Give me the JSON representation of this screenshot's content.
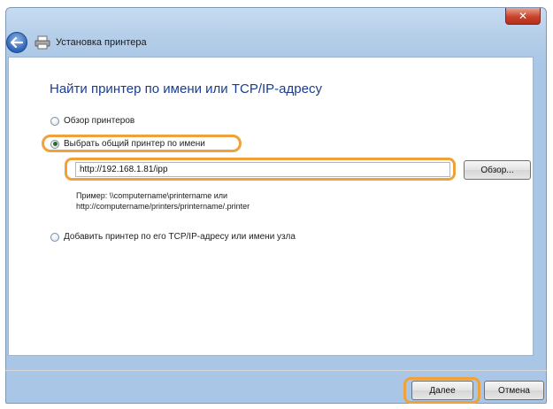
{
  "window": {
    "title": "Установка принтера"
  },
  "heading": "Найти принтер по имени или TCP/IP-адресу",
  "options": [
    {
      "label": "Обзор принтеров",
      "checked": false
    },
    {
      "label": "Выбрать общий принтер по имени",
      "checked": true
    },
    {
      "label": "Добавить принтер по его TCP/IP-адресу или имени узла",
      "checked": false
    }
  ],
  "path_field": {
    "value": "http://192.168.1.81/ipp"
  },
  "browse_label": "Обзор...",
  "example": {
    "line1": "Пример: \\\\computername\\printername или",
    "line2": "http://computername/printers/printername/.printer"
  },
  "buttons": {
    "next": "Далее",
    "cancel": "Отмена"
  },
  "colors": {
    "heading": "#1b3d8f",
    "highlight": "#f0a23a",
    "close": "#c8432b"
  },
  "icons": [
    "close-icon",
    "back-arrow-icon",
    "printer-icon"
  ]
}
